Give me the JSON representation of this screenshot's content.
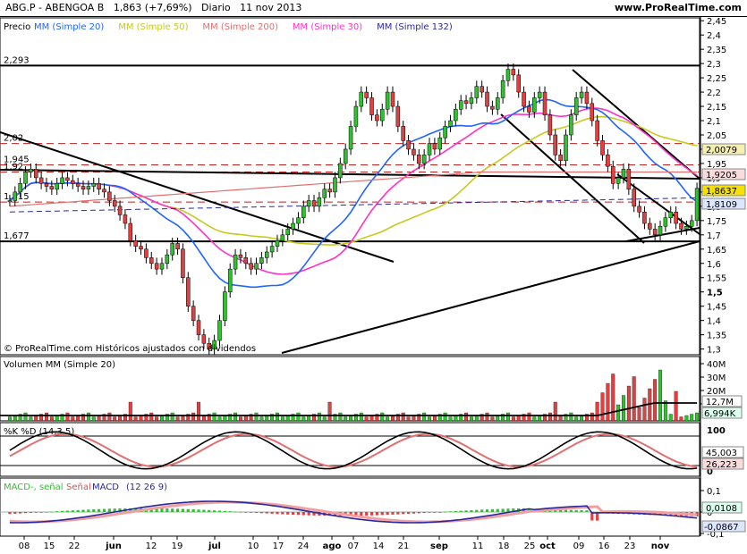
{
  "header": {
    "symbol": "ABG.P - ABENGOA B",
    "price": "1,863 (+7,69%)",
    "period": "Diario",
    "date": "11 nov 2013",
    "site": "www.ProRealTime.com"
  },
  "colors": {
    "mm20": "#1e64ff",
    "mm50": "#c8c81e",
    "mm200": "#e07070",
    "mm30": "#ff32c8",
    "mm132": "#2828a0",
    "up": "#30c030",
    "down": "#e04040",
    "hist": "#e05050",
    "macd_sig": "#f0a0a0"
  },
  "price_panel": {
    "legend_prefix": "Precio",
    "legend_items": [
      {
        "label": "MM (Simple 20)",
        "color": "#1e64ff"
      },
      {
        "label": "MM (Simple 50)",
        "color": "#c8c81e"
      },
      {
        "label": "MM (Simple 200)",
        "color": "#e07070"
      },
      {
        "label": "MM (Simple 30)",
        "color": "#ff32c8"
      },
      {
        "label": "MM (Simple 132)",
        "color": "#2828a0"
      }
    ],
    "level_labels": [
      "2,293",
      "2,02",
      "1,945",
      "1,92",
      "1,815",
      "1,677"
    ],
    "copyright": "© ProRealTime.com Históricos ajustados con dividendos",
    "y_ticks": [
      "2,45",
      "2,4",
      "2,35",
      "2,3",
      "2,25",
      "2,2",
      "2,15",
      "2,1",
      "2,05",
      "2",
      "1,95",
      "1,9",
      "1,85",
      "1,8",
      "1,75",
      "1,7",
      "1,65",
      "1,6",
      "1,55",
      "1,5",
      "1,45",
      "1,4",
      "1,35",
      "1,3"
    ],
    "price_tags": [
      {
        "text": "2,0079",
        "bg": "#f5f0b0"
      },
      {
        "text": "1,9205",
        "bg": "#fbdcdc"
      },
      {
        "text": "1,8637",
        "bg": "#f5e000"
      },
      {
        "text": "1,8109",
        "bg": "#dce6ff"
      }
    ]
  },
  "volume_panel": {
    "title": "Volumen MM (Simple 20)",
    "y_ticks": [
      "40M",
      "30M",
      "20M",
      "10M"
    ],
    "tags": [
      {
        "text": "12,7M"
      },
      {
        "text": "6,994K"
      }
    ]
  },
  "stoch_panel": {
    "title": "%K %D (14,3,5)",
    "y_ticks": [
      "100",
      "0"
    ],
    "tags": [
      {
        "text": "45,003"
      },
      {
        "text": "26,223"
      }
    ]
  },
  "macd_panel": {
    "title_a": "MACD-, señal",
    "title_b": "Señal",
    "title_c": "MACD",
    "title_d": "(12 26 9)",
    "y_ticks": [
      "0,1",
      "0",
      "-0,1"
    ],
    "tags": [
      {
        "text": "0,0108"
      },
      {
        "text": "-0,0867"
      }
    ]
  },
  "x_axis": {
    "ticks": [
      "08",
      "15",
      "22",
      "jun",
      "12",
      "19",
      "jul",
      "10",
      "17",
      "24",
      "ago",
      "07",
      "14",
      "21",
      "sep",
      "11",
      "18",
      "25",
      "oct",
      "09",
      "16",
      "23",
      "nov"
    ]
  },
  "chart_data": {
    "type": "candlestick",
    "title": "ABG.P - ABENGOA B",
    "period": "Diario",
    "ylim": [
      1.28,
      2.46
    ],
    "horizontal_levels": [
      2.293,
      2.02,
      1.945,
      1.92,
      1.815,
      1.677
    ],
    "last_close": 1.8637,
    "change_pct": "+7,69%",
    "indicator_last_values": {
      "sma20": 1.8109,
      "sma50": 2.0079,
      "sma200": 1.9205,
      "stoch_k": 45.003,
      "stoch_d": 26.223,
      "macd": -0.0867,
      "macd_signal": 0.0108
    },
    "series_note": "approximate daily closes read from chart, 8 May 2013 - 11 Nov 2013",
    "closes": [
      1.82,
      1.85,
      1.88,
      1.92,
      1.93,
      1.9,
      1.88,
      1.87,
      1.86,
      1.88,
      1.9,
      1.89,
      1.88,
      1.87,
      1.86,
      1.87,
      1.88,
      1.86,
      1.85,
      1.82,
      1.8,
      1.77,
      1.74,
      1.68,
      1.66,
      1.65,
      1.62,
      1.6,
      1.58,
      1.6,
      1.63,
      1.67,
      1.65,
      1.55,
      1.45,
      1.4,
      1.35,
      1.32,
      1.3,
      1.33,
      1.4,
      1.5,
      1.58,
      1.63,
      1.62,
      1.6,
      1.58,
      1.6,
      1.62,
      1.64,
      1.66,
      1.68,
      1.7,
      1.72,
      1.74,
      1.76,
      1.8,
      1.82,
      1.8,
      1.83,
      1.86,
      1.85,
      1.9,
      1.95,
      2.0,
      2.08,
      2.15,
      2.2,
      2.18,
      2.12,
      2.1,
      2.14,
      2.2,
      2.15,
      2.08,
      2.03,
      2.0,
      1.98,
      1.95,
      1.98,
      2.02,
      2.0,
      2.04,
      2.08,
      2.1,
      2.14,
      2.17,
      2.16,
      2.18,
      2.22,
      2.2,
      2.15,
      2.14,
      2.18,
      2.24,
      2.28,
      2.26,
      2.2,
      2.15,
      2.13,
      2.18,
      2.2,
      2.12,
      2.05,
      1.98,
      1.96,
      2.05,
      2.12,
      2.18,
      2.2,
      2.16,
      2.1,
      2.03,
      1.98,
      1.94,
      1.88,
      1.9,
      1.93,
      1.86,
      1.8,
      1.78,
      1.74,
      1.72,
      1.7,
      1.73,
      1.76,
      1.78,
      1.74,
      1.72,
      1.73,
      1.75,
      1.863
    ]
  }
}
